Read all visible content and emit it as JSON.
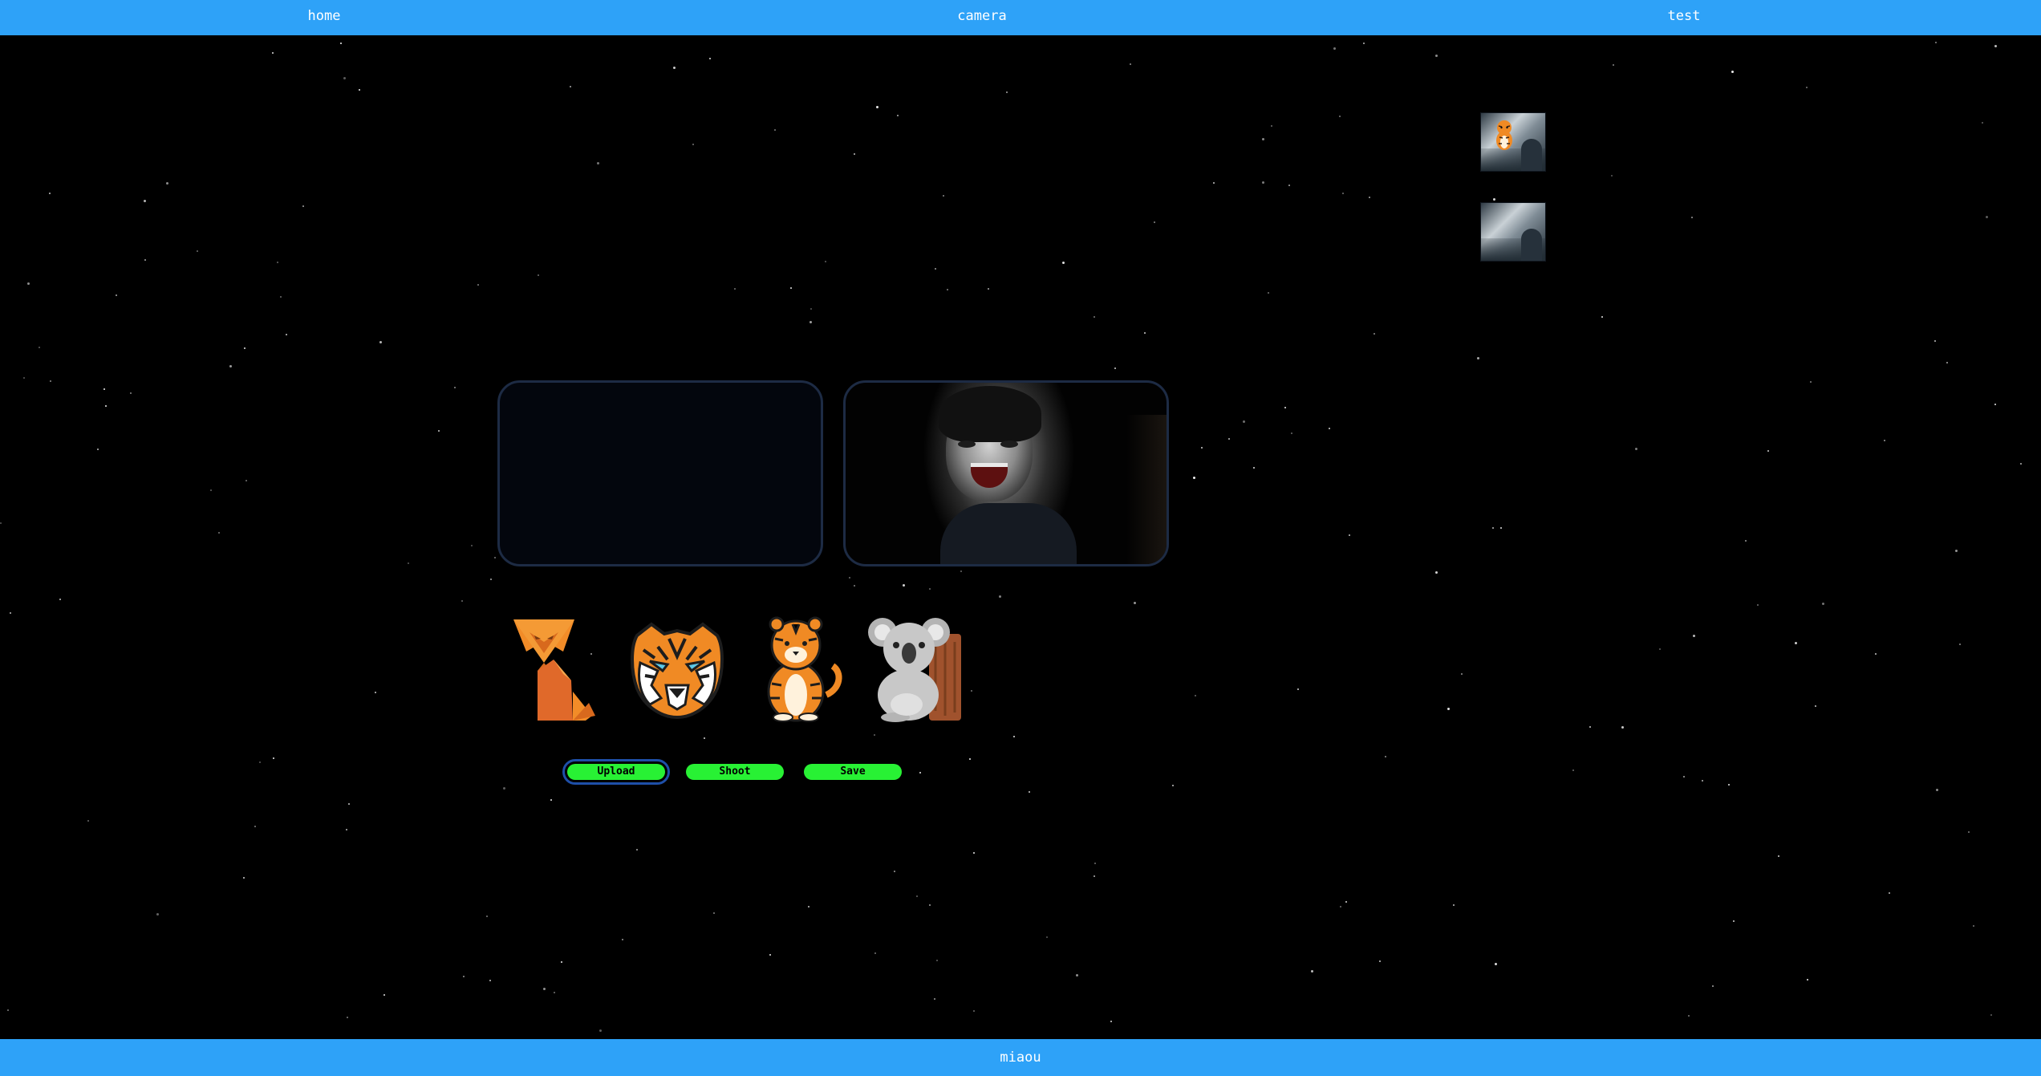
{
  "nav": {
    "home": "home",
    "camera": "camera",
    "test": "test"
  },
  "footer": {
    "text": "miaou"
  },
  "stickers": [
    {
      "name": "fox",
      "icon": "fox-icon"
    },
    {
      "name": "tiger-face",
      "icon": "tiger-face-icon"
    },
    {
      "name": "tiger-sitting",
      "icon": "tiger-sitting-icon"
    },
    {
      "name": "koala",
      "icon": "koala-icon"
    }
  ],
  "buttons": {
    "upload": "Upload",
    "shoot": "Shoot",
    "save": "Save"
  },
  "colors": {
    "bar": "#2ea2f8",
    "button": "#28f134",
    "background": "#000000",
    "frame_border": "#1d2b44"
  }
}
